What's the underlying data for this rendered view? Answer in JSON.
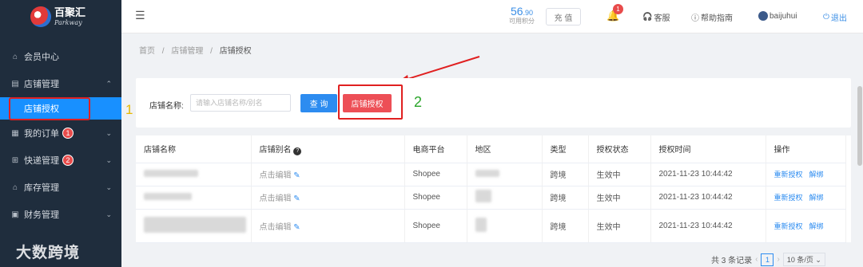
{
  "logo": {
    "cn": "百聚汇",
    "en": "Parkway"
  },
  "sidebar": {
    "items": [
      {
        "label": "会员中心",
        "icon": "home-icon"
      },
      {
        "label": "店铺管理",
        "icon": "store-icon",
        "expanded": true
      },
      {
        "label": "我的订单",
        "icon": "order-icon",
        "badge": "1"
      },
      {
        "label": "快递管理",
        "icon": "delivery-icon",
        "badge": "2"
      },
      {
        "label": "库存管理",
        "icon": "warehouse-icon"
      },
      {
        "label": "财务管理",
        "icon": "finance-icon"
      }
    ],
    "sub_item": "店铺授权"
  },
  "annotations": {
    "one": "1",
    "two": "2"
  },
  "watermark": "大数跨境",
  "header": {
    "points_int": "56",
    "points_dec": ".90",
    "points_label": "可用积分",
    "recharge": "充 值",
    "notif_count": "1",
    "service": "客服",
    "help": "帮助指南",
    "username": "baijuhui",
    "logout": "退出"
  },
  "breadcrumb": {
    "home": "首页",
    "sep": "/",
    "section": "店铺管理",
    "current": "店铺授权"
  },
  "search": {
    "label": "店铺名称:",
    "placeholder": "请输入店铺名称/别名",
    "query_button": "查 询",
    "auth_button": "店铺授权"
  },
  "table": {
    "columns": [
      "店铺名称",
      "店铺别名",
      "电商平台",
      "地区",
      "类型",
      "授权状态",
      "授权时间",
      "操作"
    ],
    "rows": [
      {
        "alias": "点击编辑",
        "platform": "Shopee",
        "type": "跨境",
        "status": "生效中",
        "time": "2021-11-23 10:44:42",
        "op1": "重新授权",
        "op2": "解绑"
      },
      {
        "alias": "点击编辑",
        "platform": "Shopee",
        "type": "跨境",
        "status": "生效中",
        "time": "2021-11-23 10:44:42",
        "op1": "重新授权",
        "op2": "解绑"
      },
      {
        "alias": "点击编辑",
        "platform": "Shopee",
        "type": "跨境",
        "status": "生效中",
        "time": "2021-11-23 10:44:42",
        "op1": "重新授权",
        "op2": "解绑"
      }
    ]
  },
  "pager": {
    "total": "共 3 条记录",
    "page": "1",
    "page_size": "10 条/页"
  },
  "colors": {
    "primary": "#2d8cf0",
    "danger": "#ed4f56",
    "sidebar": "#1f2d3d",
    "active": "#1890ff"
  }
}
